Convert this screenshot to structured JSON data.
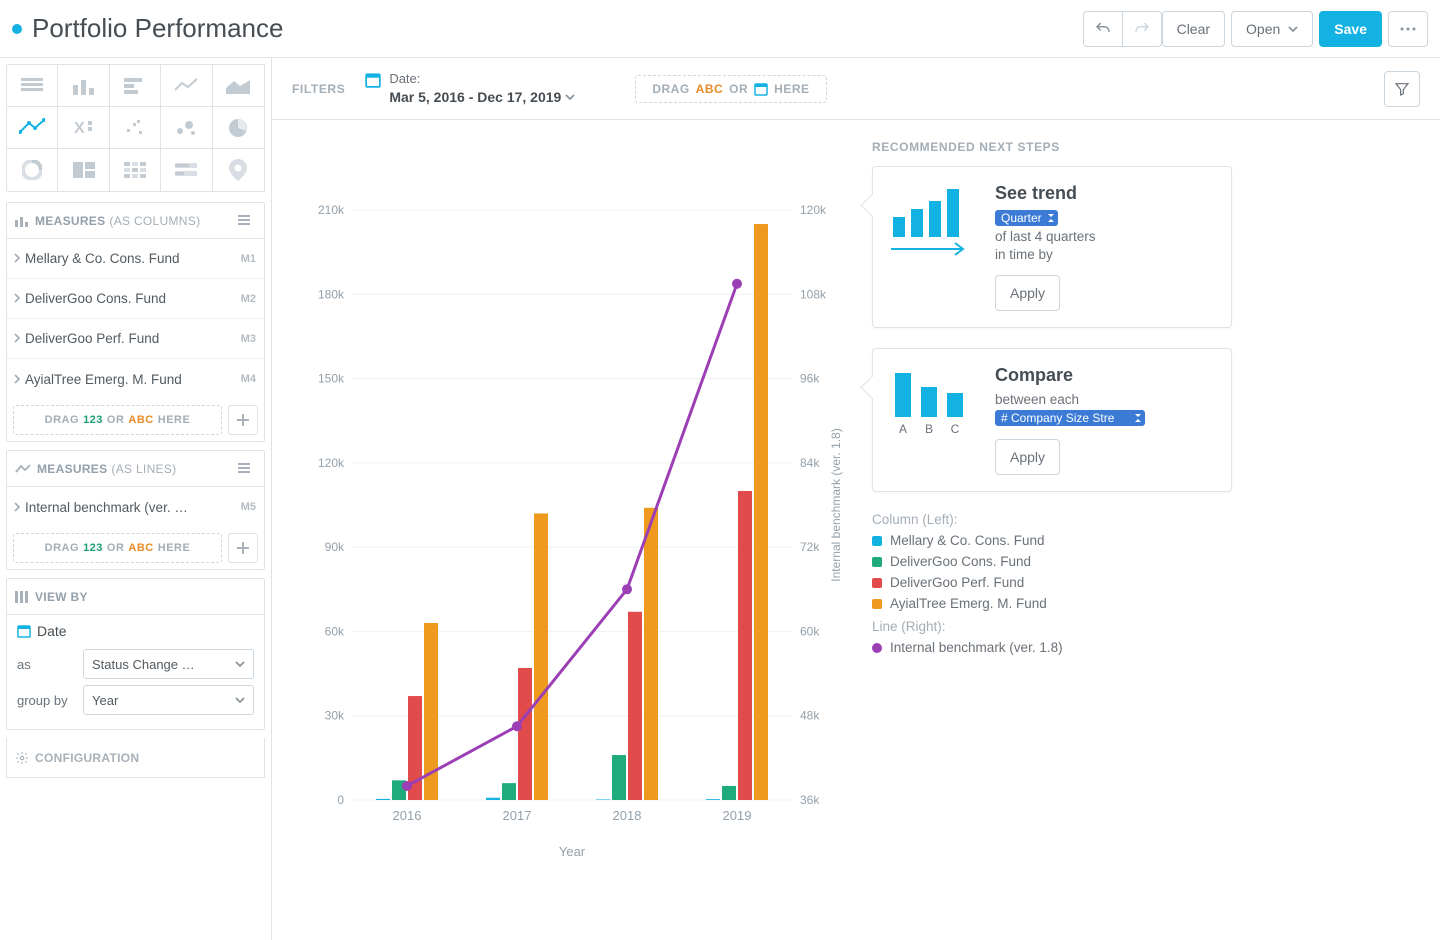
{
  "header": {
    "title": "Portfolio Performance",
    "clear": "Clear",
    "open": "Open",
    "save": "Save"
  },
  "left": {
    "measures_cols": {
      "label": "MEASURES",
      "suffix": "(AS COLUMNS)"
    },
    "measures_lines": {
      "label": "MEASURES",
      "suffix": "(AS LINES)"
    },
    "cols": [
      {
        "label": "Mellary & Co. Cons. Fund",
        "tag": "M1"
      },
      {
        "label": "DeliverGoo Cons. Fund",
        "tag": "M2"
      },
      {
        "label": "DeliverGoo Perf. Fund",
        "tag": "M3"
      },
      {
        "label": "AyialTree Emerg. M. Fund",
        "tag": "M4"
      }
    ],
    "lines": [
      {
        "label": "Internal benchmark (ver. …",
        "tag": "M5"
      }
    ],
    "drag": {
      "pre": "DRAG",
      "num": "123",
      "or": "OR",
      "abc": "ABC",
      "post": "HERE"
    },
    "viewby": {
      "title": "VIEW BY",
      "field": "Date",
      "as_label": "as",
      "as_value": "Status Change …",
      "groupby_label": "group by",
      "groupby_value": "Year"
    },
    "configuration": "CONFIGURATION"
  },
  "filters": {
    "label": "FILTERS",
    "date_label": "Date:",
    "date_value": "Mar 5, 2016 - Dec 17, 2019",
    "drag": {
      "pre": "DRAG",
      "abc": "ABC",
      "or": "OR",
      "post": "HERE"
    }
  },
  "side": {
    "title": "RECOMMENDED NEXT STEPS",
    "trend": {
      "title": "See trend",
      "period": "Quarter",
      "line1": "of last 4 quarters",
      "line2": "in time by",
      "apply": "Apply"
    },
    "compare": {
      "title": "Compare",
      "line1": "between each",
      "select": "# Company Size Stre",
      "apply": "Apply",
      "labels": [
        "A",
        "B",
        "C"
      ]
    },
    "legend": {
      "col_title": "Column (Left):",
      "line_title": "Line (Right):",
      "cols": [
        {
          "label": "Mellary & Co. Cons. Fund",
          "color": "#14b2e2"
        },
        {
          "label": "DeliverGoo Cons. Fund",
          "color": "#1fab7b"
        },
        {
          "label": "DeliverGoo Perf. Fund",
          "color": "#e14b4b"
        },
        {
          "label": "AyialTree Emerg. M. Fund",
          "color": "#ed9a1f"
        }
      ],
      "lines": [
        {
          "label": "Internal benchmark (ver. 1.8)",
          "color": "#9c3fb5"
        }
      ]
    }
  },
  "chart_data": {
    "type": "bar+line",
    "xlabel": "Year",
    "y_right_label": "Internal benchmark (ver. 1.8)",
    "categories": [
      "2016",
      "2017",
      "2018",
      "2019"
    ],
    "left_axis": {
      "range": [
        0,
        210000
      ],
      "ticks": [
        0,
        30000,
        60000,
        90000,
        120000,
        150000,
        180000,
        210000
      ],
      "tick_labels": [
        "0",
        "30k",
        "60k",
        "90k",
        "120k",
        "150k",
        "180k",
        "210k"
      ]
    },
    "right_axis": {
      "range": [
        36000,
        120000
      ],
      "ticks": [
        36000,
        48000,
        60000,
        72000,
        84000,
        96000,
        108000,
        120000
      ],
      "tick_labels": [
        "36k",
        "48k",
        "60k",
        "72k",
        "84k",
        "96k",
        "108k",
        "120k"
      ]
    },
    "series_bars": [
      {
        "name": "Mellary & Co. Cons. Fund",
        "color": "#14b2e2",
        "values": [
          400,
          800,
          200,
          300
        ]
      },
      {
        "name": "DeliverGoo Cons. Fund",
        "color": "#1fab7b",
        "values": [
          7000,
          6000,
          16000,
          5000
        ]
      },
      {
        "name": "DeliverGoo Perf. Fund",
        "color": "#e14b4b",
        "values": [
          37000,
          47000,
          67000,
          110000
        ]
      },
      {
        "name": "AyialTree Emerg. M. Fund",
        "color": "#ed9a1f",
        "values": [
          63000,
          102000,
          104000,
          205000
        ]
      }
    ],
    "series_line": {
      "name": "Internal benchmark (ver. 1.8)",
      "color": "#9c3fb5",
      "values": [
        38000,
        46500,
        66000,
        109500
      ]
    }
  }
}
